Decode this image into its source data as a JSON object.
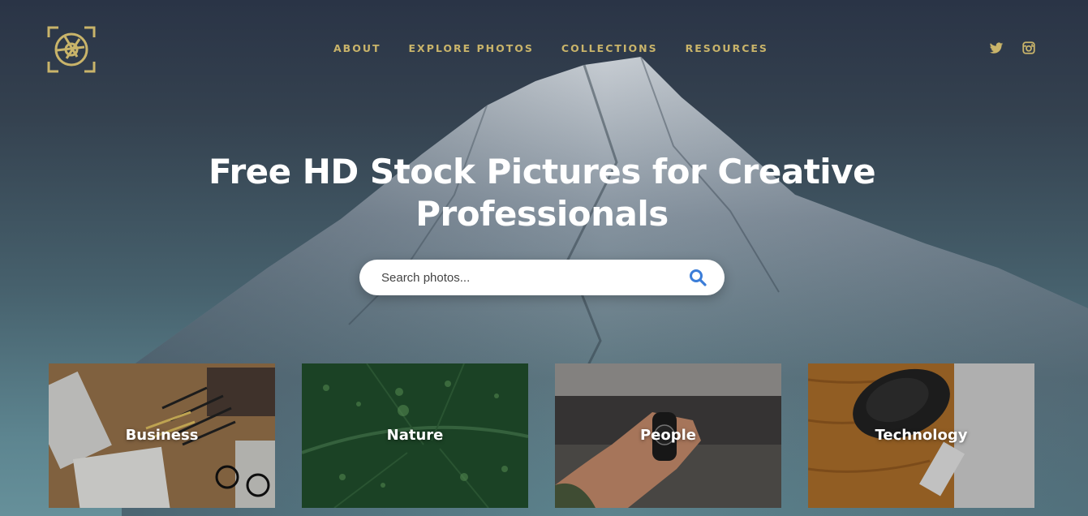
{
  "brand": {
    "logo_icon": "camera-aperture-icon",
    "accent_color": "#c9b46a"
  },
  "nav": {
    "items": [
      {
        "label": "ABOUT"
      },
      {
        "label": "EXPLORE PHOTOS"
      },
      {
        "label": "COLLECTIONS"
      },
      {
        "label": "RESOURCES"
      }
    ]
  },
  "social": [
    {
      "icon": "twitter-icon"
    },
    {
      "icon": "instagram-icon"
    }
  ],
  "hero": {
    "title_line1": "Free HD Stock Pictures for Creative",
    "title_line2": "Professionals"
  },
  "search": {
    "placeholder": "Search photos...",
    "value": "",
    "icon": "search-icon",
    "icon_color": "#3b7dd8"
  },
  "categories": [
    {
      "label": "Business"
    },
    {
      "label": "Nature"
    },
    {
      "label": "People"
    },
    {
      "label": "Technology"
    }
  ]
}
